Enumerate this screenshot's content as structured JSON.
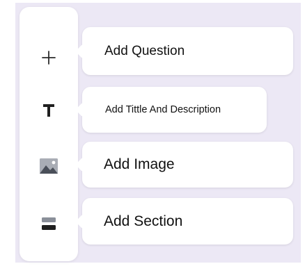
{
  "toolbar": {
    "items": [
      {
        "icon": "plus-icon",
        "tooltip": "Add Question"
      },
      {
        "icon": "text-icon",
        "tooltip": "Add Tittle And Description"
      },
      {
        "icon": "image-icon",
        "tooltip": "Add Image"
      },
      {
        "icon": "section-icon",
        "tooltip": "Add Section"
      }
    ]
  },
  "colors": {
    "background": "#ece8f5",
    "toolbar": "#ffffff",
    "icon_dark": "#1f1f1f",
    "icon_muted": "#8a8f99"
  }
}
